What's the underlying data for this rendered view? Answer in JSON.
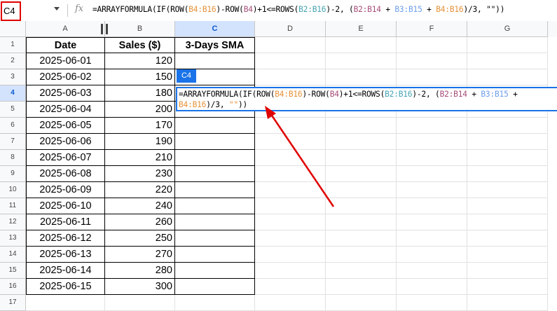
{
  "name_box": "C4",
  "formula_segments": [
    {
      "t": "=ARRAYFORMULA(",
      "c": ""
    },
    {
      "t": "IF(ROW(",
      "c": ""
    },
    {
      "t": "B4:B16",
      "c": "t1"
    },
    {
      "t": ")-ROW(",
      "c": ""
    },
    {
      "t": "B4",
      "c": "t2"
    },
    {
      "t": ")+1<=ROWS(",
      "c": ""
    },
    {
      "t": "B2:B16",
      "c": "t4"
    },
    {
      "t": ")-2, (",
      "c": ""
    },
    {
      "t": "B2:B14",
      "c": "t2"
    },
    {
      "t": " + ",
      "c": ""
    },
    {
      "t": "B3:B15",
      "c": "t3"
    },
    {
      "t": " + ",
      "c": ""
    },
    {
      "t": "B4:B16",
      "c": "t1"
    },
    {
      "t": ")/3, \"\"))",
      "c": ""
    }
  ],
  "editor_line1": [
    {
      "t": "=ARRAYFORMULA(IF(ROW(",
      "c": ""
    },
    {
      "t": "B4:B16",
      "c": "t1"
    },
    {
      "t": ")-ROW(",
      "c": ""
    },
    {
      "t": "B4",
      "c": "t2"
    },
    {
      "t": ")+1<=ROWS(",
      "c": ""
    },
    {
      "t": "B2:B16",
      "c": "t4"
    },
    {
      "t": ")-2, (",
      "c": ""
    },
    {
      "t": "B2:B14",
      "c": "t2"
    },
    {
      "t": " + ",
      "c": ""
    },
    {
      "t": "B3:B15",
      "c": "t3"
    },
    {
      "t": " +",
      "c": ""
    }
  ],
  "editor_line2": [
    {
      "t": "B4:B16",
      "c": "t1"
    },
    {
      "t": ")/3, ",
      "c": ""
    },
    {
      "t": "\"\"",
      "c": "t1"
    },
    {
      "t": "))",
      "c": ""
    }
  ],
  "editor_chip": "C4",
  "columns": [
    "A",
    "B",
    "C",
    "D",
    "E",
    "F",
    "G"
  ],
  "header_row": {
    "date": "Date",
    "sales": "Sales ($)",
    "sma": "3-Days SMA"
  },
  "rows": [
    {
      "date": "2025-06-01",
      "sales": "120"
    },
    {
      "date": "2025-06-02",
      "sales": "150"
    },
    {
      "date": "2025-06-03",
      "sales": "180"
    },
    {
      "date": "2025-06-04",
      "sales": "200"
    },
    {
      "date": "2025-06-05",
      "sales": "170"
    },
    {
      "date": "2025-06-06",
      "sales": "190"
    },
    {
      "date": "2025-06-07",
      "sales": "210"
    },
    {
      "date": "2025-06-08",
      "sales": "230"
    },
    {
      "date": "2025-06-09",
      "sales": "220"
    },
    {
      "date": "2025-06-10",
      "sales": "240"
    },
    {
      "date": "2025-06-11",
      "sales": "260"
    },
    {
      "date": "2025-06-12",
      "sales": "250"
    },
    {
      "date": "2025-06-13",
      "sales": "270"
    },
    {
      "date": "2025-06-14",
      "sales": "280"
    },
    {
      "date": "2025-06-15",
      "sales": "300"
    }
  ],
  "row_numbers": [
    "1",
    "2",
    "3",
    "4",
    "5",
    "6",
    "7",
    "8",
    "9",
    "10",
    "11",
    "12",
    "13",
    "14",
    "15",
    "16",
    "17"
  ],
  "colors": {
    "accent": "#1a73e8",
    "annotation": "#e00000",
    "header_bg": "#f8f9fa",
    "selected_header": "#d3e3fd"
  }
}
